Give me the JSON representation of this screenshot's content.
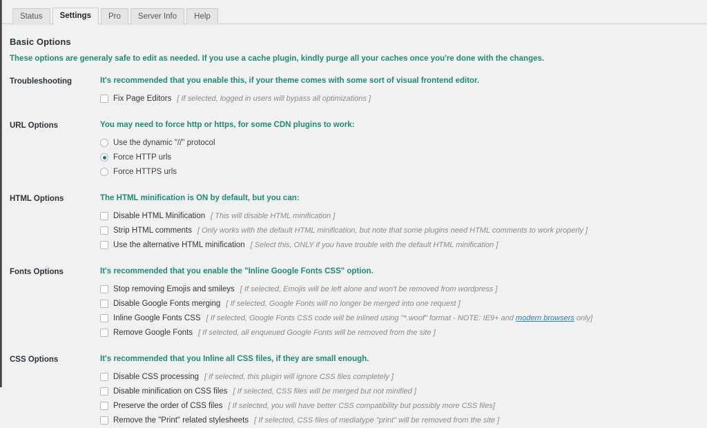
{
  "colors": {
    "accent_teal": "#1f8a7a",
    "link_blue": "#2a7fbf",
    "radio_dot": "#1d6fa5",
    "page_bg": "#f1f1f1",
    "hint_gray": "#8a8a8a"
  },
  "tabs": [
    {
      "label": "Status",
      "active": false
    },
    {
      "label": "Settings",
      "active": true
    },
    {
      "label": "Pro",
      "active": false
    },
    {
      "label": "Server Info",
      "active": false
    },
    {
      "label": "Help",
      "active": false
    }
  ],
  "header": {
    "title": "Basic Options",
    "description": "These options are generaly safe to edit as needed. If you use a cache plugin, kindly purge all your caches once you're done with the changes."
  },
  "sections": [
    {
      "label": "Troubleshooting",
      "note": "It's recommended that you enable this, if your theme comes with some sort of visual frontend editor.",
      "control_type": "checkbox",
      "options": [
        {
          "label": "Fix Page Editors",
          "hint": "[ If selected, logged in users will bypass all optimizations ]",
          "checked": false
        }
      ]
    },
    {
      "label": "URL Options",
      "note": "You may need to force http or https, for some CDN plugins to work:",
      "control_type": "radio",
      "options": [
        {
          "label": "Use the dynamic \"//\" protocol",
          "hint": "",
          "checked": false
        },
        {
          "label": "Force HTTP urls",
          "hint": "",
          "checked": true
        },
        {
          "label": "Force HTTPS urls",
          "hint": "",
          "checked": false
        }
      ]
    },
    {
      "label": "HTML Options",
      "note": "The HTML minification is ON by default, but you can:",
      "control_type": "checkbox",
      "options": [
        {
          "label": "Disable HTML Minification",
          "hint": "[ This will disable HTML minification ]",
          "checked": false
        },
        {
          "label": "Strip HTML comments",
          "hint": "[ Only works with the default HTML minification, but note that some plugins need HTML comments to work properly ]",
          "checked": false
        },
        {
          "label": "Use the alternative HTML minification",
          "hint": "[ Select this, ONLY if you have trouble with the default HTML minification ]",
          "checked": false
        }
      ]
    },
    {
      "label": "Fonts Options",
      "note": "It's recommended that you enable the \"Inline Google Fonts CSS\" option.",
      "control_type": "checkbox",
      "options": [
        {
          "label": "Stop removing Emojis and smileys",
          "hint": "[ If selected, Emojis will be left alone and won't be removed from wordpress ]",
          "checked": false
        },
        {
          "label": "Disable Google Fonts merging",
          "hint": "[ If selected, Google Fonts will no longer be merged into one request ]",
          "checked": false
        },
        {
          "label": "Inline Google Fonts CSS",
          "hint_parts": [
            {
              "text": "[ If selected, Google Fonts CSS code will be inlined using \"*.woof\" format - NOTE: IE9+ and ",
              "link": false
            },
            {
              "text": "modern browsers",
              "link": true
            },
            {
              "text": " only]",
              "link": false
            }
          ],
          "checked": false
        },
        {
          "label": "Remove Google Fonts",
          "hint": "[ If selected, all enqueued Google Fonts will be removed from the site ]",
          "checked": false
        }
      ]
    },
    {
      "label": "CSS Options",
      "note": "It's recommended that you Inline all CSS files, if they are small enough.",
      "control_type": "checkbox",
      "options": [
        {
          "label": "Disable CSS processing",
          "hint": "[ If selected, this plugin will ignore CSS files completely ]",
          "checked": false
        },
        {
          "label": "Disable minification on CSS files",
          "hint": "[ If selected, CSS files will be merged but not minified ]",
          "checked": false
        },
        {
          "label": "Preserve the order of CSS files",
          "hint": "[ If selected, you will have better CSS compatibility but possibly more CSS files]",
          "checked": false
        },
        {
          "label": "Remove the \"Print\" related stylesheets",
          "hint": "[ If selected, CSS files of mediatype \"print\" will be removed from the site ]",
          "checked": false
        }
      ]
    }
  ]
}
